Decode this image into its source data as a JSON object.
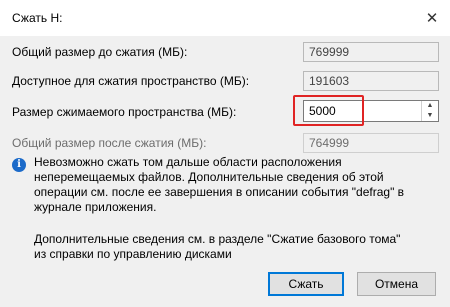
{
  "window": {
    "title": "Сжать H:",
    "close_icon": "close-icon"
  },
  "rows": {
    "total_before": {
      "label": "Общий размер до сжатия (МБ):",
      "value": "769999"
    },
    "available": {
      "label": "Доступное для сжатия пространство (МБ):",
      "value": "191603"
    },
    "shrink": {
      "label": "Размер сжимаемого пространства (МБ):",
      "value": "5000"
    },
    "total_after": {
      "label": "Общий размер после сжатия (МБ):",
      "value": "764999"
    }
  },
  "info": {
    "icon": "info-icon",
    "text": "Невозможно сжать том дальше области расположения неперемещаемых файлов. Дополнительные сведения об этой операции см. после ее завершения в описании события \"defrag\" в журнале приложения."
  },
  "more": "Дополнительные сведения см. в разделе \"Сжатие базового тома\" из справки по управлению дисками",
  "buttons": {
    "shrink": "Сжать",
    "cancel": "Отмена"
  },
  "spin": {
    "up": "▲",
    "down": "▼"
  },
  "colors": {
    "highlight": "#e02424",
    "primary_border": "#0078d7",
    "dialog_bg": "#f0f0f0"
  }
}
